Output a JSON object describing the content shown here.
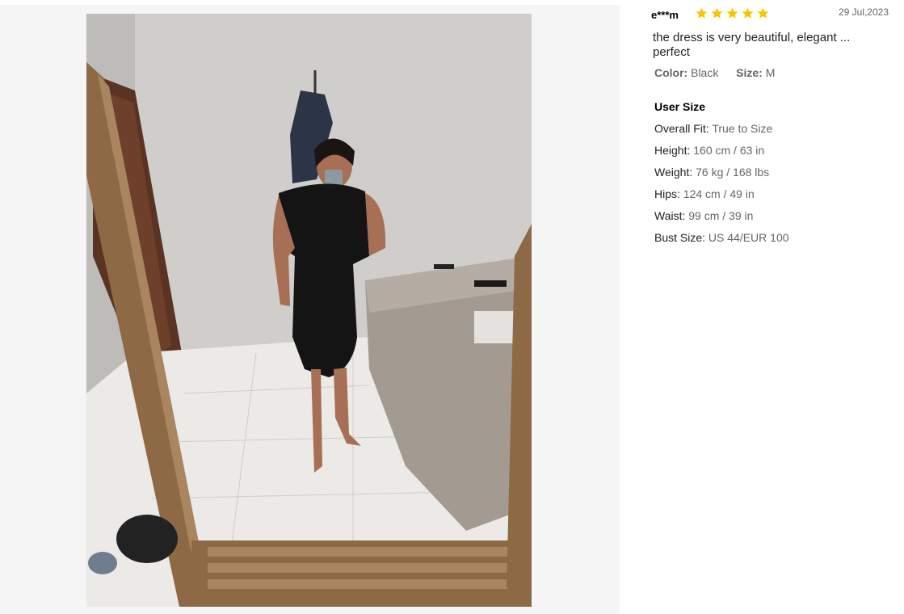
{
  "review": {
    "user": "e***m",
    "rating": 5,
    "date": "29 Jul,2023",
    "content": "the dress is very beautiful, elegant ... perfect",
    "attributes": [
      {
        "label": "Color:",
        "value": "Black"
      },
      {
        "label": "Size:",
        "value": "M"
      }
    ],
    "user_size_title": "User Size",
    "user_size": [
      {
        "label": "Overall Fit:",
        "value": "True to Size"
      },
      {
        "label": "Height:",
        "value": "160 cm / 63 in"
      },
      {
        "label": "Weight:",
        "value": "76 kg / 168 lbs"
      },
      {
        "label": "Hips:",
        "value": "124 cm / 49 in"
      },
      {
        "label": "Waist:",
        "value": "99 cm / 39 in"
      },
      {
        "label": "Bust Size:",
        "value": "US 44/EUR 100"
      }
    ]
  },
  "colors": {
    "star": "#f7c600",
    "muted": "#666666"
  }
}
